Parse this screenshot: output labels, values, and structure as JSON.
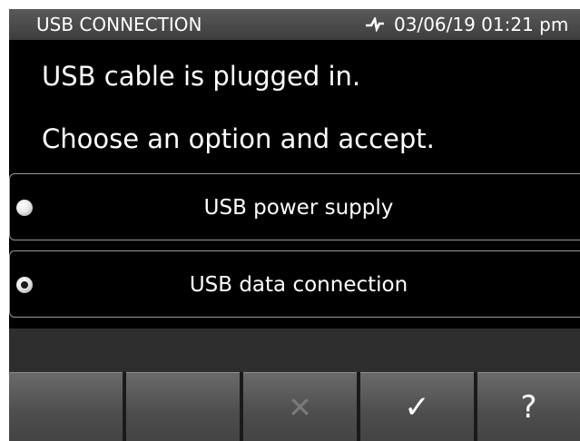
{
  "header": {
    "title": "USB CONNECTION",
    "status_icon": "power-plug-icon",
    "datetime": "03/06/19 01:21 pm"
  },
  "messages": {
    "line1": "USB cable is plugged in.",
    "line2": "Choose an option and accept."
  },
  "options": [
    {
      "label": "USB power supply",
      "selected": false
    },
    {
      "label": "USB data connection",
      "selected": true
    }
  ],
  "softkeys": [
    {
      "glyph": "",
      "enabled": false
    },
    {
      "glyph": "",
      "enabled": false
    },
    {
      "glyph": "✕",
      "icon": "cancel-icon",
      "enabled": false
    },
    {
      "glyph": "✓",
      "icon": "accept-icon",
      "enabled": true
    },
    {
      "glyph": "?",
      "icon": "help-icon",
      "enabled": true
    }
  ],
  "colors": {
    "background": "#000000",
    "header": "#4a4a4a",
    "softkey": "#555555",
    "disabled_glyph": "#7a7a7a"
  }
}
